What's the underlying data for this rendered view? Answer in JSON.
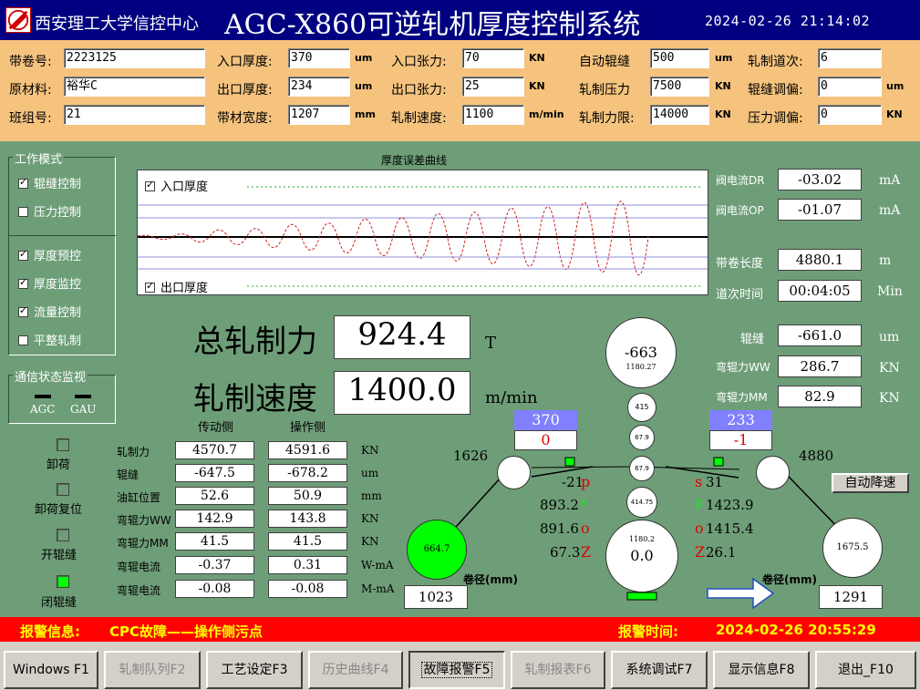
{
  "title": {
    "org": "西安理工大学信控中心",
    "system": "AGC-X860可逆轧机厚度控制系统",
    "clock": "2024-02-26  21:14:02"
  },
  "params": [
    {
      "label": "带卷号:",
      "value": "2223125",
      "unit": ""
    },
    {
      "label": "入口厚度:",
      "value": "370",
      "unit": "um"
    },
    {
      "label": "入口张力:",
      "value": "70",
      "unit": "KN"
    },
    {
      "label": "自动辊缝",
      "value": "500",
      "unit": "um"
    },
    {
      "label": "轧制道次:",
      "value": "6",
      "unit": ""
    },
    {
      "label": "原材料:",
      "value": "裕华C",
      "unit": ""
    },
    {
      "label": "出口厚度:",
      "value": "234",
      "unit": "um"
    },
    {
      "label": "出口张力:",
      "value": "25",
      "unit": "KN"
    },
    {
      "label": "轧制压力",
      "value": "7500",
      "unit": "KN"
    },
    {
      "label": "辊缝调偏:",
      "value": "0",
      "unit": "um"
    },
    {
      "label": "班组号:",
      "value": "21",
      "unit": ""
    },
    {
      "label": "带材宽度:",
      "value": "1207",
      "unit": "mm"
    },
    {
      "label": "轧制速度:",
      "value": "1100",
      "unit": "m/min"
    },
    {
      "label": "轧制力限:",
      "value": "14000",
      "unit": "KN"
    },
    {
      "label": "压力调偏:",
      "value": "0",
      "unit": "KN"
    }
  ],
  "modes": {
    "title": "工作模式",
    "items": [
      {
        "label": "辊缝控制",
        "checked": true
      },
      {
        "label": "压力控制",
        "checked": false
      },
      {
        "label": "厚度预控",
        "checked": true
      },
      {
        "label": "厚度监控",
        "checked": true
      },
      {
        "label": "流量控制",
        "checked": true
      },
      {
        "label": "平整轧制",
        "checked": false
      }
    ]
  },
  "comm": {
    "title": "通信状态监视",
    "agc": "AGC",
    "gau": "GAU"
  },
  "chart": {
    "title": "厚度误差曲线",
    "entry_label": "入口厚度",
    "exit_label": "出口厚度"
  },
  "right": {
    "valve_dr": {
      "label": "阀电流DR",
      "value": "-03.02",
      "unit": "mA"
    },
    "valve_op": {
      "label": "阀电流OP",
      "value": "-01.07",
      "unit": "mA"
    },
    "coil_len": {
      "label": "带卷长度",
      "value": "4880.1",
      "unit": "m"
    },
    "pass_time": {
      "label": "道次时间",
      "value": "00:04:05",
      "unit": "Min"
    },
    "gap": {
      "label": "辊缝",
      "value": "-661.0",
      "unit": "um"
    },
    "bend_ww": {
      "label": "弯辊力WW",
      "value": "286.7",
      "unit": "KN"
    },
    "bend_mm": {
      "label": "弯辊力MM",
      "value": "82.9",
      "unit": "KN"
    }
  },
  "big": {
    "force_label": "总轧制力",
    "force_value": "924.4",
    "force_unit": "T",
    "speed_label": "轧制速度",
    "speed_value": "1400.0",
    "speed_unit": "m/min"
  },
  "table": {
    "h_drive": "传动侧",
    "h_oper": "操作侧",
    "rows": [
      {
        "label": "轧制力",
        "drive": "4570.7",
        "oper": "4591.6",
        "unit": "KN"
      },
      {
        "label": "辊缝",
        "drive": "-647.5",
        "oper": "-678.2",
        "unit": "um"
      },
      {
        "label": "油缸位置",
        "drive": "52.6",
        "oper": "50.9",
        "unit": "mm"
      },
      {
        "label": "弯辊力WW",
        "drive": "142.9",
        "oper": "143.8",
        "unit": "KN"
      },
      {
        "label": "弯辊力MM",
        "drive": "41.5",
        "oper": "41.5",
        "unit": "KN"
      },
      {
        "label": "弯辊电流",
        "drive": "-0.37",
        "oper": "0.31",
        "unit": "W-mA"
      },
      {
        "label": "弯辊电流",
        "drive": "-0.08",
        "oper": "-0.08",
        "unit": "M-mA"
      }
    ]
  },
  "actions": [
    {
      "label": "卸荷",
      "on": false
    },
    {
      "label": "卸荷复位",
      "on": false
    },
    {
      "label": "开辊缝",
      "on": false
    },
    {
      "label": "闭辊缝",
      "on": true
    }
  ],
  "mill": {
    "top_work": "-663",
    "top_sub": "1180.27",
    "roll_415": "415",
    "roll_679a": "67.9",
    "roll_679b": "67.9",
    "roll_1475": "414.75",
    "bot_sub": "1180.2",
    "bot_val": "0.0",
    "entry_box_top": "370",
    "entry_box_bot": "0",
    "exit_box_top": "233",
    "exit_box_bot": "-1",
    "left_len": "1626",
    "right_len": "4880",
    "left_p": "-21",
    "left_p_k": "p",
    "left_s": "893.2",
    "left_s_k": "s",
    "left_o": "891.6",
    "left_o_k": "o",
    "left_z": "67.3",
    "left_z_k": "Z",
    "right_s": "31",
    "right_s_k": "s",
    "right_p": "1423.9",
    "right_p_k": "p",
    "right_o": "1415.4",
    "right_o_k": "o",
    "right_z": "26.1",
    "right_z_k": "Z",
    "left_coil": "664.7",
    "right_coil": "1675.5",
    "dia_label_l": "卷径(mm)",
    "dia_label_r": "卷径(mm)",
    "dia_left": "1023",
    "dia_right": "1291"
  },
  "auto_decel": "自动降速",
  "alarm": {
    "label": "报警信息:",
    "text": "CPC故障——操作侧污点",
    "time_label": "报警时间:",
    "time": "2024-02-26  20:55:29"
  },
  "fkeys": [
    {
      "label": "Windows F1",
      "disabled": false,
      "active": false
    },
    {
      "label": "轧制队列F2",
      "disabled": true,
      "active": false
    },
    {
      "label": "工艺设定F3",
      "disabled": false,
      "active": false
    },
    {
      "label": "历史曲线F4",
      "disabled": true,
      "active": false
    },
    {
      "label": "故障报警F5",
      "disabled": false,
      "active": true
    },
    {
      "label": "轧制报表F6",
      "disabled": true,
      "active": false
    },
    {
      "label": "系统调试F7",
      "disabled": false,
      "active": false
    },
    {
      "label": "显示信息F8",
      "disabled": false,
      "active": false
    },
    {
      "label": "退出_F10",
      "disabled": false,
      "active": false
    }
  ],
  "colors": {
    "panel": "#6e9e78",
    "params": "#f5c37e",
    "title": "#000080",
    "alarm": "#ff0000",
    "led_on": "#00ff00",
    "accent_box": "#8080ff"
  }
}
